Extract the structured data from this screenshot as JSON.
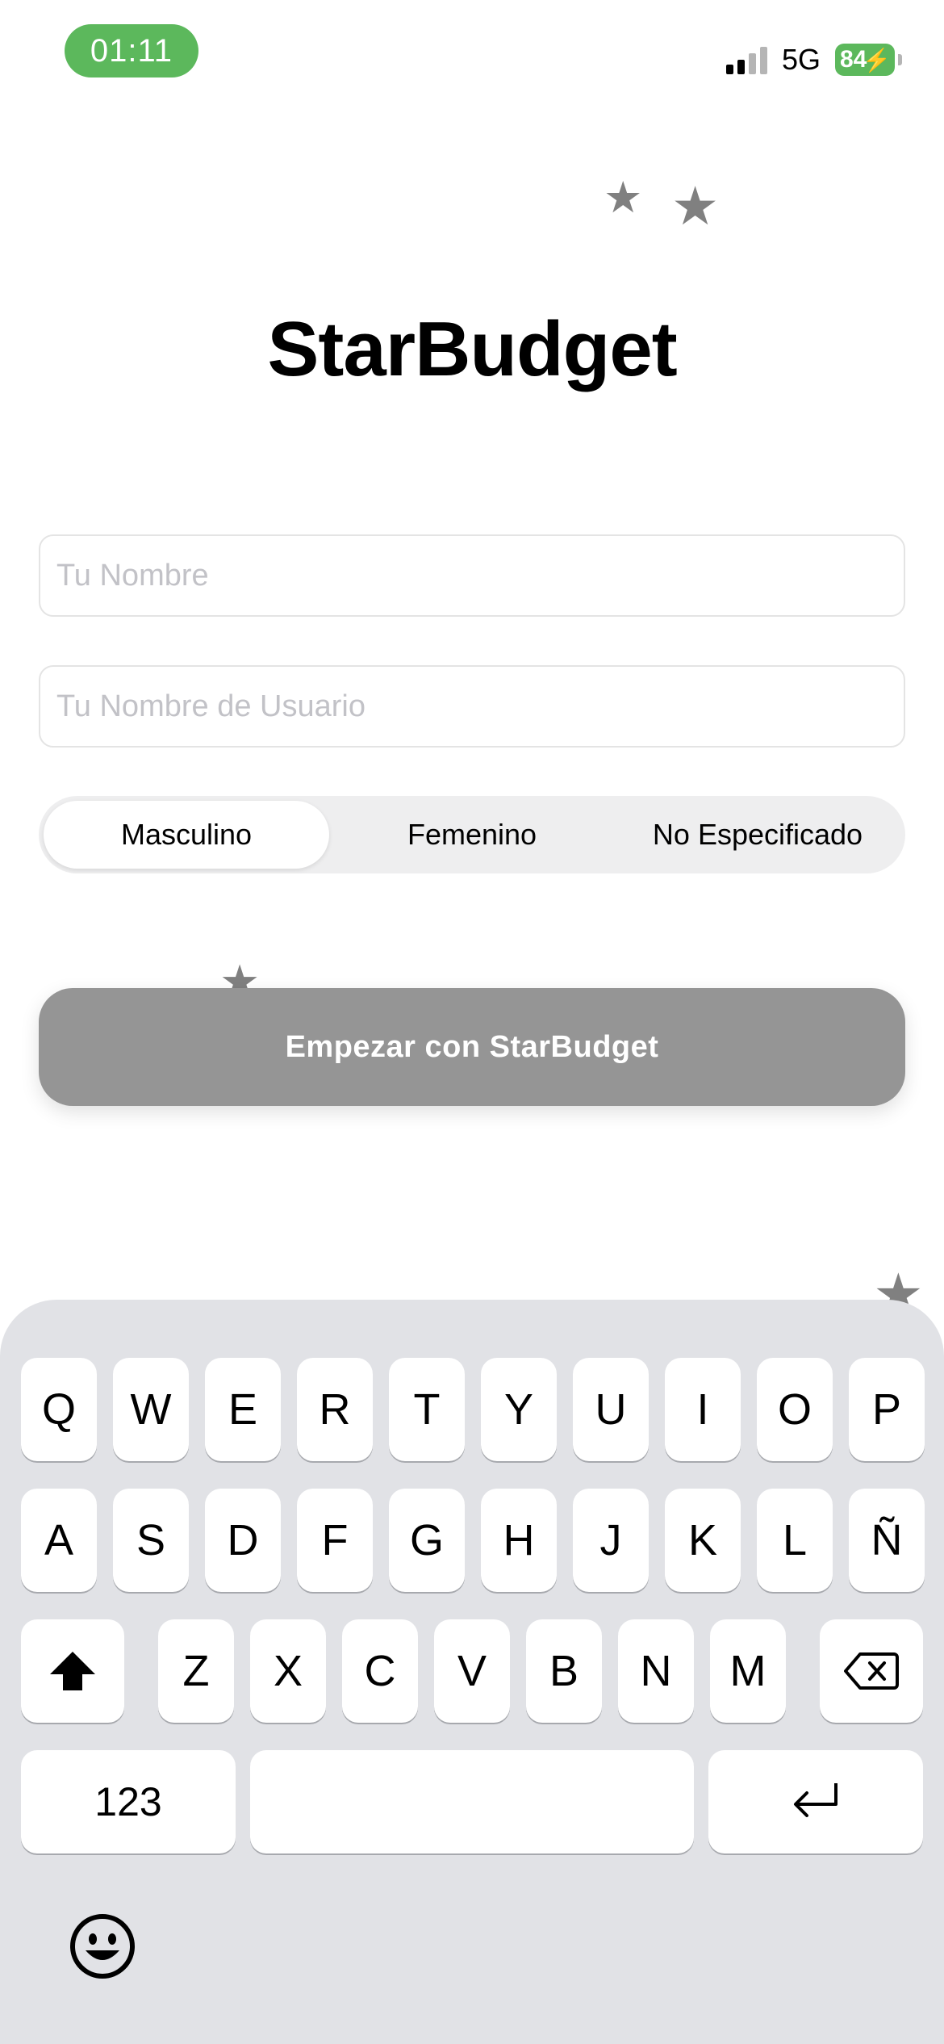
{
  "status_bar": {
    "time": "01:11",
    "network": "5G",
    "battery": "84"
  },
  "app": {
    "title": "StarBudget"
  },
  "form": {
    "name_placeholder": "Tu Nombre",
    "username_placeholder": "Tu Nombre de Usuario",
    "gender_options": [
      "Masculino",
      "Femenino",
      "No Especificado"
    ],
    "selected_gender": "Masculino",
    "submit_label": "Empezar con StarBudget"
  },
  "keyboard": {
    "row1": [
      "Q",
      "W",
      "E",
      "R",
      "T",
      "Y",
      "U",
      "I",
      "O",
      "P"
    ],
    "row2": [
      "A",
      "S",
      "D",
      "F",
      "G",
      "H",
      "J",
      "K",
      "L",
      "Ñ"
    ],
    "row3": [
      "Z",
      "X",
      "C",
      "V",
      "B",
      "N",
      "M"
    ],
    "numbers_label": "123",
    "icons": {
      "shift": "shift-icon",
      "delete": "backspace-icon",
      "return": "return-icon",
      "emoji": "emoji-icon"
    }
  },
  "colors": {
    "time_pill": "#5cb85c",
    "battery": "#5cb85c",
    "button_disabled": "#959595",
    "star": "#808080",
    "keyboard_bg": "#e1e2e6"
  }
}
